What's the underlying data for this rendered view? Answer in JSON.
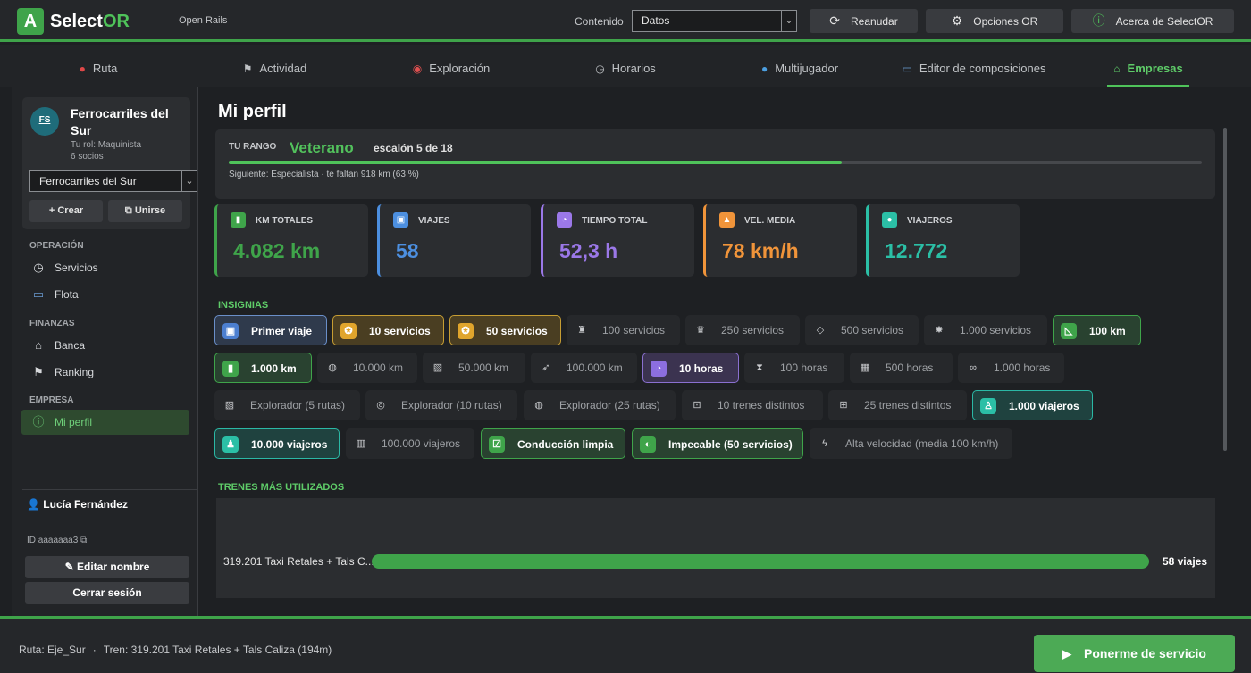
{
  "app": {
    "logo_glyph": "A",
    "brand_main": "Select",
    "brand_accent": "OR",
    "product": "Open Rails"
  },
  "header": {
    "content_label": "Contenido",
    "content_value": "Datos",
    "buttons": [
      {
        "label": "Reanudar",
        "icon": "resume-icon"
      },
      {
        "label": "Opciones OR",
        "icon": "gear-icon"
      },
      {
        "label": "Acerca de SelectOR",
        "icon": "info-icon"
      }
    ]
  },
  "tabs": [
    {
      "label": "Ruta",
      "icon": "pin-icon"
    },
    {
      "label": "Actividad",
      "icon": "flag-icon"
    },
    {
      "label": "Exploración",
      "icon": "compass-icon"
    },
    {
      "label": "Horarios",
      "icon": "clock-icon"
    },
    {
      "label": "Multijugador",
      "icon": "globe-icon"
    },
    {
      "label": "Editor de composiciones",
      "icon": "train-icon"
    },
    {
      "label": "Empresas",
      "icon": "bank-icon",
      "active": true
    }
  ],
  "company": {
    "initials": "FS",
    "name": "Ferrocarriles del Sur",
    "role": "Tu rol: Maquinista",
    "members": "6 socios",
    "selected": "Ferrocarriles del Sur",
    "create_label": "+ Crear",
    "join_label": "Unirse"
  },
  "nav": {
    "operacion_title": "OPERACIÓN",
    "servicios": "Servicios",
    "flota": "Flota",
    "finanzas_title": "FINANZAS",
    "banca": "Banca",
    "ranking": "Ranking",
    "empresa_title": "EMPRESA",
    "mi_perfil": "Mi perfil"
  },
  "user": {
    "name": "Lucía Fernández",
    "id_text": "ID aaaaaaa3",
    "edit_label": "Editar nombre",
    "logout_label": "Cerrar sesión"
  },
  "profile": {
    "title": "Mi perfil",
    "rank_label": "TU RANGO",
    "rank_name": "Veterano",
    "rank_step": "escalón 5 de 18",
    "progress": 0.63,
    "next_text": "Siguiente: Especialista · te faltan 918 km (63 %)"
  },
  "stats": [
    {
      "label": "KM TOTALES",
      "value": "4.082 km",
      "color": "#3fa44a"
    },
    {
      "label": "VIAJES",
      "value": "58",
      "color": "#4c8fe0"
    },
    {
      "label": "TIEMPO TOTAL",
      "value": "52,3 h",
      "color": "#9b78e8"
    },
    {
      "label": "VEL. MEDIA",
      "value": "78 km/h",
      "color": "#f0943a"
    },
    {
      "label": "VIAJEROS",
      "value": "12.772",
      "color": "#2bbfa6"
    }
  ],
  "badges_title": "INSIGNIAS",
  "badges": [
    {
      "label": "Primer viaje",
      "state": "blue"
    },
    {
      "label": "10 servicios",
      "state": "gold"
    },
    {
      "label": "50 servicios",
      "state": "gold"
    },
    {
      "label": "100 servicios",
      "state": "off"
    },
    {
      "label": "250 servicios",
      "state": "off"
    },
    {
      "label": "500 servicios",
      "state": "off"
    },
    {
      "label": "1.000 servicios",
      "state": "off"
    },
    {
      "label": "100 km",
      "state": "green"
    },
    {
      "label": "1.000 km",
      "state": "green"
    },
    {
      "label": "10.000 km",
      "state": "off"
    },
    {
      "label": "50.000 km",
      "state": "off"
    },
    {
      "label": "100.000 km",
      "state": "off"
    },
    {
      "label": "10 horas",
      "state": "purple"
    },
    {
      "label": "100 horas",
      "state": "off"
    },
    {
      "label": "500 horas",
      "state": "off"
    },
    {
      "label": "1.000 horas",
      "state": "off"
    },
    {
      "label": "Explorador (5 rutas)",
      "state": "off"
    },
    {
      "label": "Explorador (10 rutas)",
      "state": "off"
    },
    {
      "label": "Explorador (25 rutas)",
      "state": "off"
    },
    {
      "label": "10 trenes distintos",
      "state": "off"
    },
    {
      "label": "25 trenes distintos",
      "state": "off"
    },
    {
      "label": "1.000 viajeros",
      "state": "teal"
    },
    {
      "label": "10.000 viajeros",
      "state": "teal"
    },
    {
      "label": "100.000 viajeros",
      "state": "off"
    },
    {
      "label": "Conducción limpia",
      "state": "green"
    },
    {
      "label": "Impecable (50 servicios)",
      "state": "green"
    },
    {
      "label": "Alta velocidad (media 100 km/h)",
      "state": "off"
    }
  ],
  "trains_title": "TRENES MÁS UTILIZADOS",
  "trains": [
    {
      "name": "319.201 Taxi Retales + Tals C...",
      "count": "58 viajes"
    }
  ],
  "footer": {
    "route": "Ruta: Eje_Sur",
    "separator": "·",
    "train": "Tren: 319.201 Taxi Retales + Tals Caliza (194m)",
    "start_label": "Ponerme de servicio"
  }
}
